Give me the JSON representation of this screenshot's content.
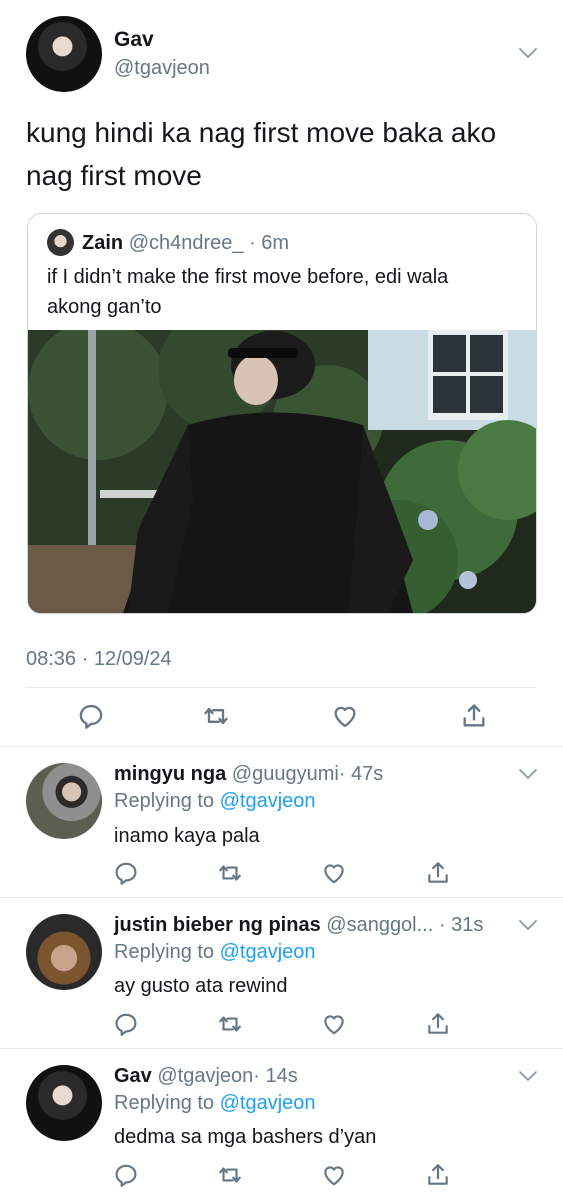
{
  "main_tweet": {
    "name": "Gav",
    "handle": "@tgavjeon",
    "text_line1": "kung hindi ka nag first move baka ako",
    "text_line2": "nag first move",
    "timestamp": "08:36 · 12/09/24"
  },
  "quoted_tweet": {
    "name": "Zain",
    "handle": "@ch4ndree_",
    "time": "· 6m",
    "text_line1": "if I didn’t make the first move before, edi wala",
    "text_line2": "akong gan’to"
  },
  "replies": [
    {
      "name": "mingyu nga",
      "handle": "@guugyumi",
      "time": "· 47s",
      "replying_prefix": "Replying to",
      "replying_to": "@tgavjeon",
      "text": "inamo kaya pala"
    },
    {
      "name": "justin bieber ng pinas",
      "handle": "@sanggol...",
      "time": "· 31s",
      "replying_prefix": "Replying to",
      "replying_to": "@tgavjeon",
      "text": "ay gusto ata rewind"
    },
    {
      "name": "Gav",
      "handle": "@tgavjeon",
      "time": "· 14s",
      "replying_prefix": "Replying to",
      "replying_to": "@tgavjeon",
      "text": "dedma sa mga bashers d’yan"
    }
  ],
  "icons": [
    "chevron-down-icon",
    "reply-icon",
    "retweet-icon",
    "like-icon",
    "share-icon"
  ],
  "colors": {
    "accent": "#1da1f2",
    "secondary_text": "#657786",
    "divider": "#e6ecf0"
  }
}
